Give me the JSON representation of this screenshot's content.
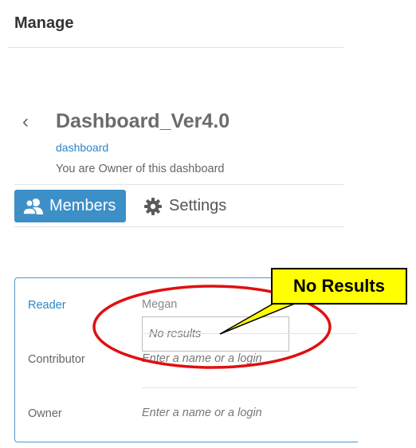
{
  "header": {
    "title": "Manage"
  },
  "dashboard": {
    "back_label": "‹",
    "title": "Dashboard_Ver4.0",
    "link_text": "dashboard",
    "ownership_note": "You are Owner of this dashboard"
  },
  "tabs": [
    {
      "label": "Members",
      "icon": "users-icon",
      "active": true
    },
    {
      "label": "Settings",
      "icon": "gear-icon",
      "active": false
    }
  ],
  "roles": {
    "reader": {
      "label": "Reader",
      "value": "Megan",
      "dropdown_text": "No results"
    },
    "contributor": {
      "label": "Contributor",
      "placeholder": "Enter a name or a login"
    },
    "owner": {
      "label": "Owner",
      "placeholder": "Enter a name or a login"
    }
  },
  "annotation": {
    "callout_text": "No Results",
    "callout_color": "#ffff00",
    "ellipse_color": "#e01010"
  },
  "colors": {
    "accent": "#3d8fc8",
    "link": "#2b86c5"
  }
}
